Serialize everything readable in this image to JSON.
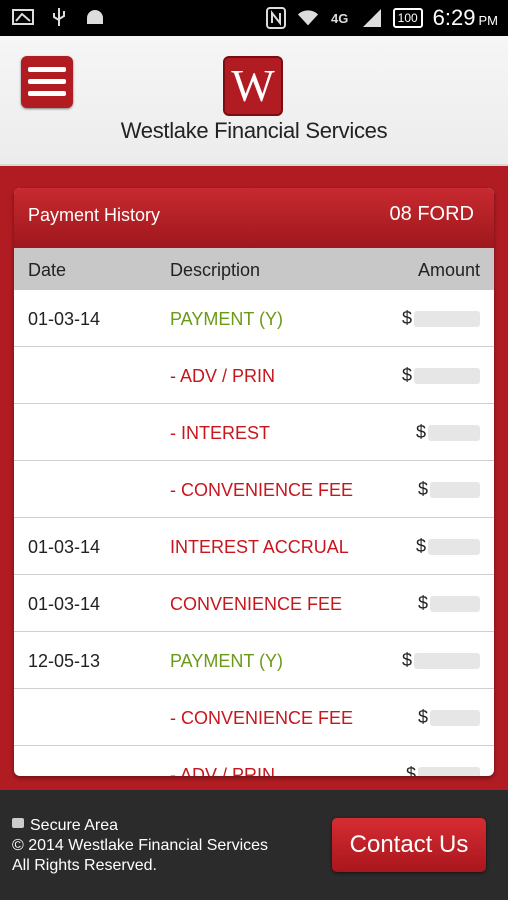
{
  "status_bar": {
    "left_icons": [
      "image-icon",
      "usb-icon",
      "android-icon"
    ],
    "right_icons": [
      "nfc-icon",
      "wifi-icon",
      "network-4g-icon",
      "signal-icon"
    ],
    "network": "4G",
    "battery": "100",
    "time": "6:29",
    "ampm": "PM"
  },
  "header": {
    "logo_letter": "W",
    "brand": "Westlake Financial Services"
  },
  "panel": {
    "title": "Payment History",
    "vehicle": "08 FORD",
    "columns": {
      "date": "Date",
      "description": "Description",
      "amount": "Amount"
    },
    "rows": [
      {
        "date": "01-03-14",
        "description": "PAYMENT (Y)",
        "amount": "$",
        "color": "#6a9a1a"
      },
      {
        "date": "",
        "description": "- ADV / PRIN",
        "amount": "$",
        "color": "#c8161d"
      },
      {
        "date": "",
        "description": "- INTEREST",
        "amount": "$",
        "color": "#c8161d"
      },
      {
        "date": "",
        "description": "- CONVENIENCE FEE",
        "amount": "$",
        "color": "#c8161d"
      },
      {
        "date": "01-03-14",
        "description": "INTEREST ACCRUAL",
        "amount": "$",
        "color": "#c8161d"
      },
      {
        "date": "01-03-14",
        "description": "CONVENIENCE FEE",
        "amount": "$",
        "color": "#c8161d"
      },
      {
        "date": "12-05-13",
        "description": "PAYMENT (Y)",
        "amount": "$",
        "color": "#6a9a1a"
      },
      {
        "date": "",
        "description": "- CONVENIENCE FEE",
        "amount": "$",
        "color": "#c8161d"
      },
      {
        "date": "",
        "description": "- ADV / PRIN",
        "amount": "$",
        "color": "#c8161d"
      }
    ]
  },
  "footer": {
    "secure": "Secure Area",
    "copyright": "© 2014 Westlake Financial Services",
    "rights": "All Rights Reserved.",
    "contact_label": "Contact Us"
  },
  "colors": {
    "brand_red": "#b01c22",
    "payment_green": "#6a9a1a",
    "charge_red": "#c8161d"
  }
}
